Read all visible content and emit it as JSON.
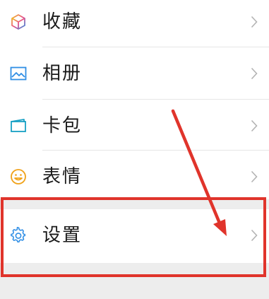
{
  "menu": {
    "items": [
      {
        "label": "收藏",
        "icon": "favorites-cube-icon"
      },
      {
        "label": "相册",
        "icon": "album-picture-icon"
      },
      {
        "label": "卡包",
        "icon": "card-wallet-icon"
      },
      {
        "label": "表情",
        "icon": "emoji-smile-icon"
      },
      {
        "label": "设置",
        "icon": "settings-gear-icon"
      }
    ]
  },
  "colors": {
    "annotation_red": "#e0342b",
    "row_background": "#ffffff",
    "page_background": "#ededed",
    "icon_blue": "#2f8ee5",
    "icon_teal": "#18a0c4",
    "icon_orange": "#f0a21a"
  }
}
